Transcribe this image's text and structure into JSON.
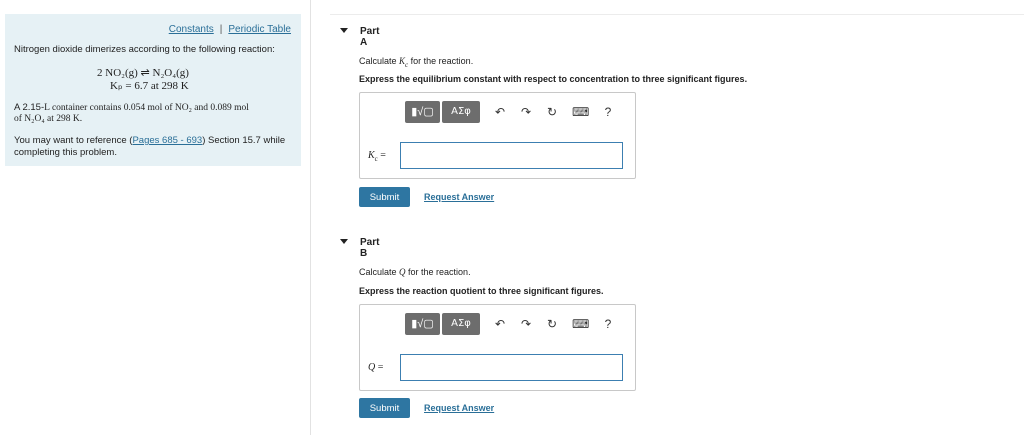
{
  "info": {
    "constants_link": "Constants",
    "separator": "|",
    "periodic_link": "Periodic Table",
    "intro": "Nitrogen dioxide dimerizes according to the following reaction:",
    "equation": "2 NO₂(g) ⇌ N₂O₄(g)",
    "kp_line": "Kₚ = 6.7 at 298 K",
    "container_line1_prefix": "A 2.15-",
    "container_L": "L",
    "container_line1_rest": " container contains 0.054 mol of NO₂ and 0.089 mol",
    "container_line2": "of N₂O₄ at 298 K.",
    "ref_line1_prefix": "You may want to reference (",
    "ref_link": "Pages 685 - 693",
    "ref_line1_suffix": ") Section 15.7 while",
    "ref_line2": "completing this problem."
  },
  "partA": {
    "title": "Part A",
    "calc_prefix": "Calculate ",
    "calc_symbol": "K",
    "calc_sub": "c",
    "calc_suffix": " for the reaction.",
    "express": "Express the equilibrium constant with respect to concentration to three significant figures.",
    "label": "K",
    "label_sub": "c",
    "label_eq": " =",
    "input_value": "",
    "submit": "Submit",
    "request": "Request Answer"
  },
  "partB": {
    "title": "Part B",
    "calc_prefix": "Calculate ",
    "calc_symbol": "Q",
    "calc_suffix": " for the reaction.",
    "express": "Express the reaction quotient to three significant figures.",
    "label": "Q",
    "label_eq": " =",
    "input_value": "",
    "submit": "Submit",
    "request": "Request Answer"
  },
  "toolbar": {
    "templates_label": "▮√▢",
    "greek_label": "ΑΣφ",
    "undo_icon": "↶",
    "redo_icon": "↷",
    "reset_icon": "↻",
    "keyboard_icon": "⌨",
    "help_icon": "?"
  }
}
